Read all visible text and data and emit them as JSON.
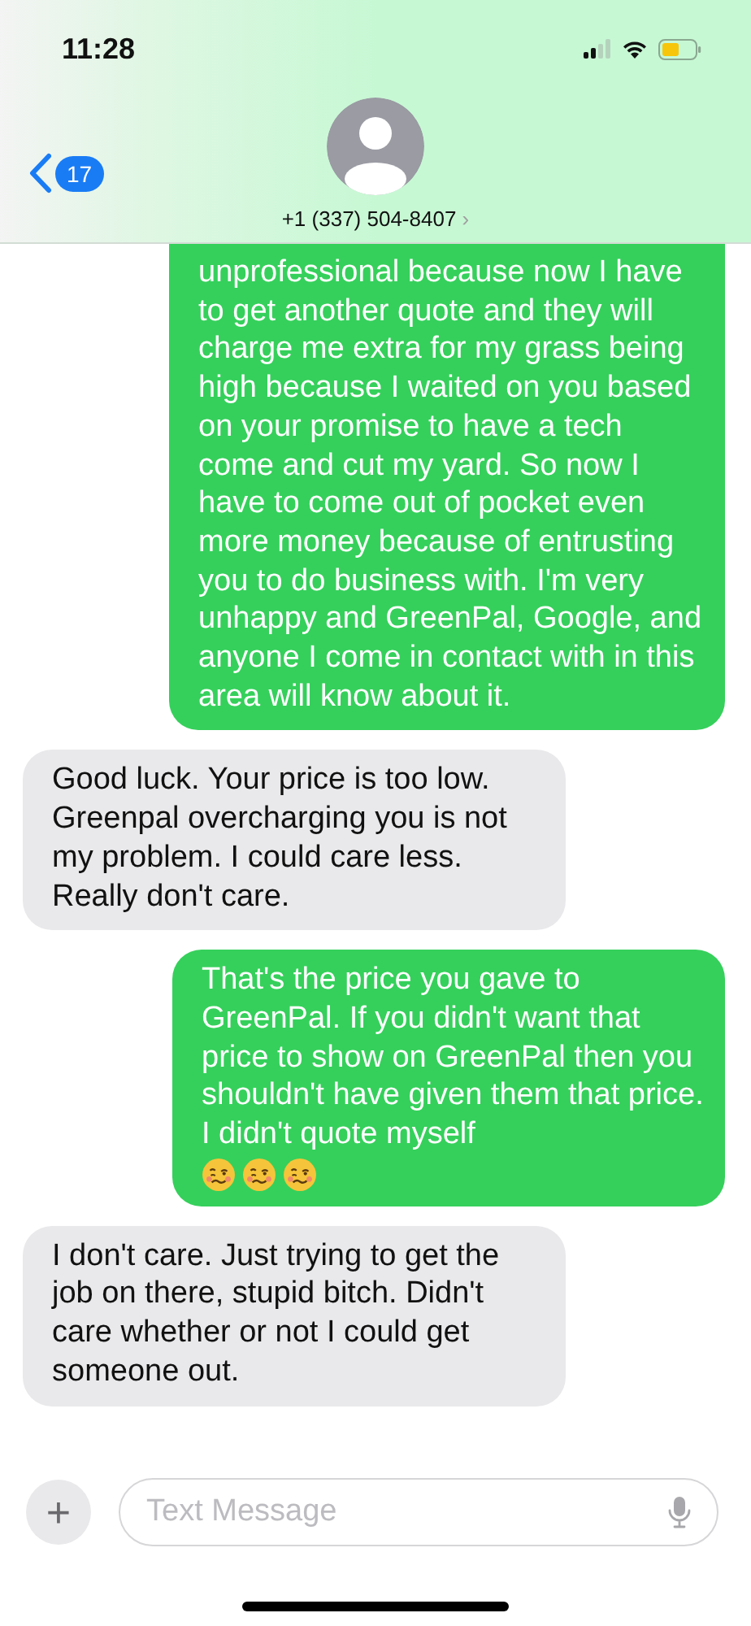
{
  "status_bar": {
    "time": "11:28"
  },
  "header": {
    "back_count": "17",
    "contact": "+1 (337) 504-8407",
    "chevron": "›"
  },
  "messages": [
    {
      "kind": "sent",
      "text": "unprofessional because now I have to get another quote and they will charge me extra for my grass being high because I waited on you based on your promise to have a tech come and cut my yard. So now I have to come out of pocket even more money because of entrusting you to do business with. I'm very unhappy and GreenPal, Google, and anyone I come in contact with in this area will know about it.",
      "clipped": true
    },
    {
      "kind": "received",
      "text": "Good luck. Your price is too low. Greenpal overcharging you is not my problem. I could care less. Really don't care."
    },
    {
      "kind": "sent",
      "text": "That's the price you gave to GreenPal. If you didn't want that price to show on GreenPal then you shouldn't have given them that price. I didn't quote myself",
      "emojis": [
        {
          "kind": "woozy"
        },
        {
          "kind": "woozy"
        },
        {
          "kind": "woozy"
        }
      ]
    },
    {
      "kind": "received",
      "text": "I don't care. Just trying to get the job on there, stupid bitch. Didn't care whether or not I could get someone out."
    }
  ],
  "composer": {
    "plus": "+",
    "placeholder": "Text Message"
  }
}
